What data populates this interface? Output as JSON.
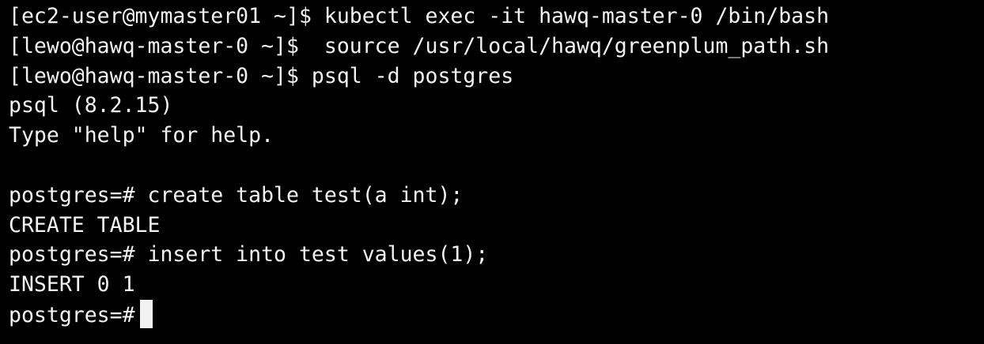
{
  "terminal": {
    "background": "#000000",
    "foreground": "#f2f2f2",
    "lines": [
      "[ec2-user@mymaster01 ~]$ kubectl exec -it hawq-master-0 /bin/bash",
      "[lewo@hawq-master-0 ~]$  source /usr/local/hawq/greenplum_path.sh",
      "[lewo@hawq-master-0 ~]$ psql -d postgres",
      "psql (8.2.15)",
      "Type \"help\" for help.",
      "",
      "postgres=# create table test(a int);",
      "CREATE TABLE",
      "postgres=# insert into test values(1);",
      "INSERT 0 1"
    ],
    "prompt": "postgres=#"
  }
}
